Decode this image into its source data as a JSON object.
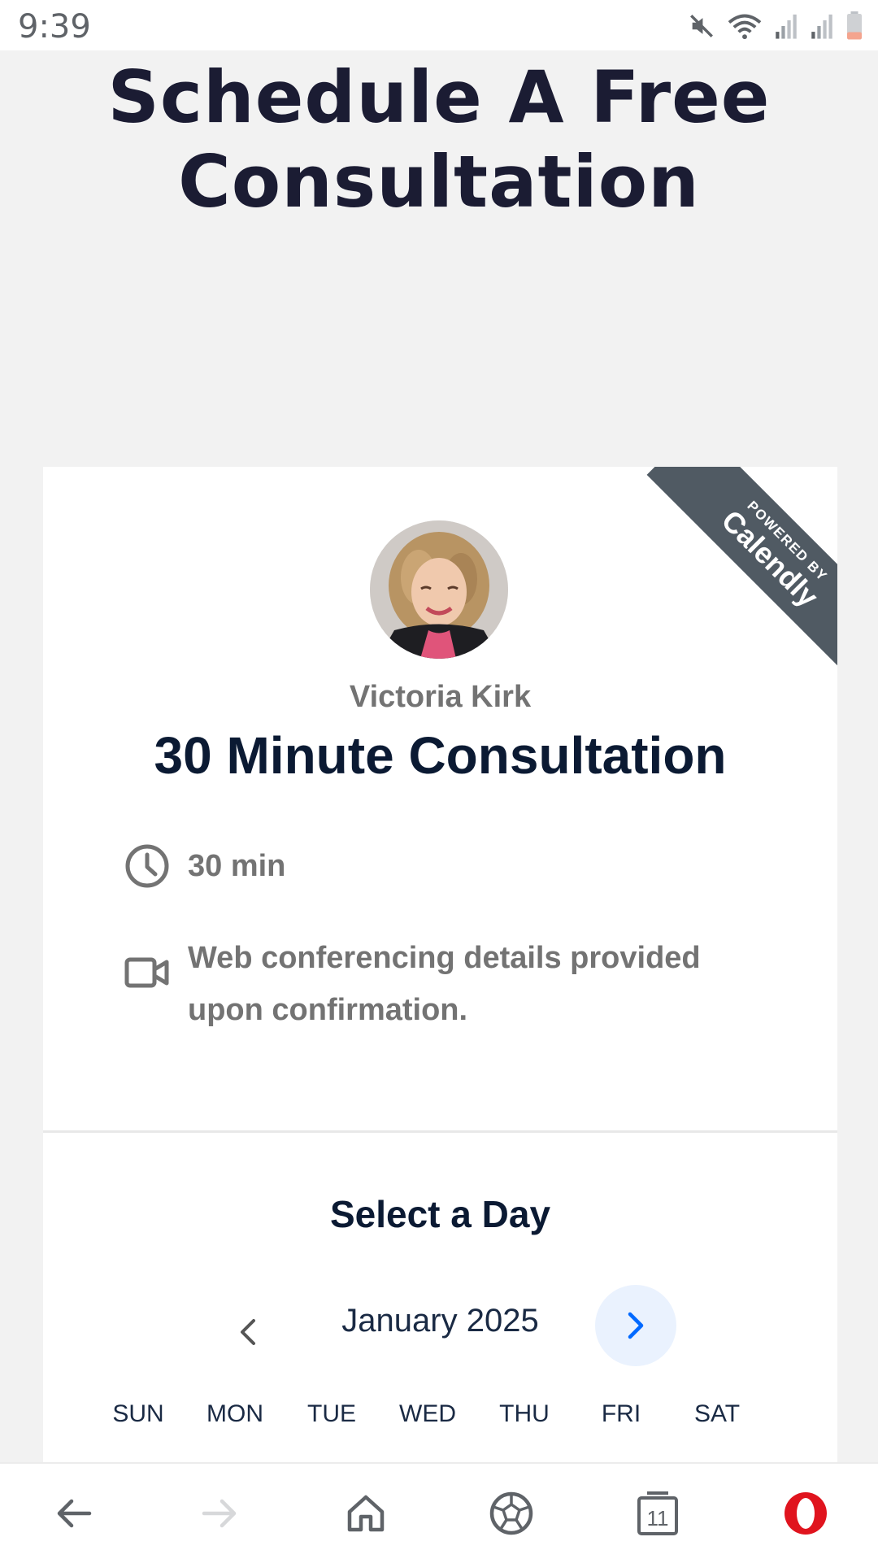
{
  "status_bar": {
    "time": "9:39",
    "icons": [
      "mute-icon",
      "wifi-icon",
      "signal-icon",
      "signal-icon",
      "battery-icon"
    ]
  },
  "page": {
    "title_line1": "Schedule A Free",
    "title_line2": "Consultation"
  },
  "card": {
    "ribbon_small": "POWERED BY",
    "ribbon_big": "Calendly",
    "host_name": "Victoria Kirk",
    "event_title": "30 Minute Consultation",
    "duration": "30 min",
    "conferencing_line1": "Web conferencing details provided",
    "conferencing_line2": "upon confirmation.",
    "section_title": "Select a Day",
    "month_label": "January 2025",
    "weekdays": [
      "SUN",
      "MON",
      "TUE",
      "WED",
      "THU",
      "FRI",
      "SAT"
    ]
  },
  "bottom_nav": {
    "tabs_count": "11"
  },
  "colors": {
    "title": "#1b1c33",
    "accent_blue": "#0069ff",
    "ribbon": "#505a63",
    "opera_red": "#e0141e"
  }
}
